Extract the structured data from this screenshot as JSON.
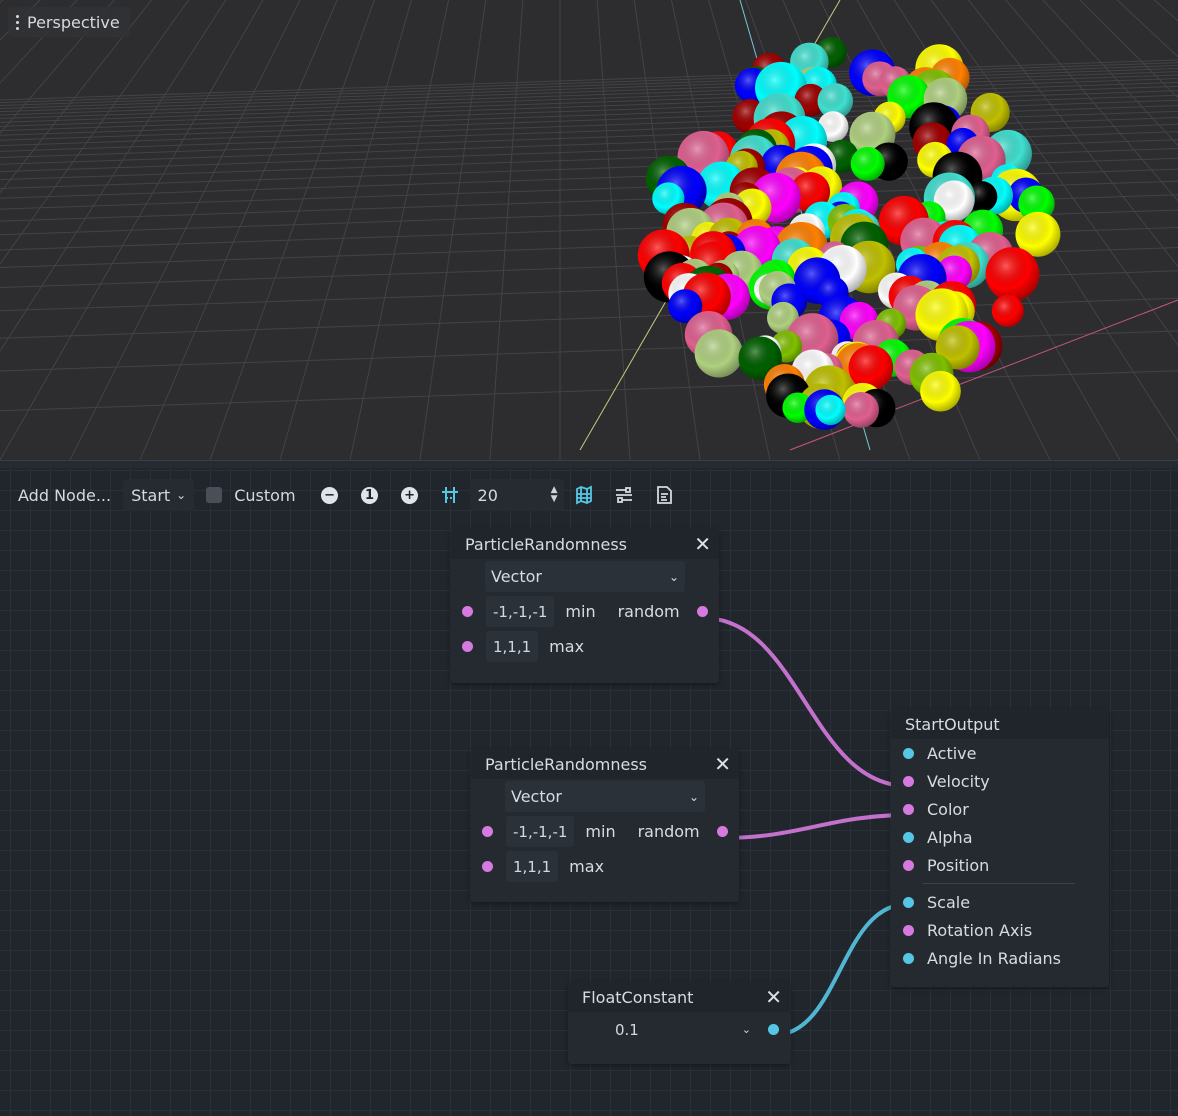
{
  "viewport": {
    "menu_label": "Perspective",
    "sphere_colors": [
      "#00ff00",
      "#ff0000",
      "#0000ff",
      "#ffff00",
      "#ff00ff",
      "#00ffff",
      "#000000",
      "#ffffff",
      "#ff8000",
      "#80c000",
      "#40e0d0",
      "#e06090",
      "#a00000",
      "#006000",
      "#b0d080",
      "#c0c000"
    ]
  },
  "toolbar": {
    "add_node_label": "Add Node...",
    "stage_select": "Start",
    "custom_label": "Custom",
    "zoom_out_icon": "minus-circle-icon",
    "zoom_reset_label": "1",
    "zoom_in_icon": "plus-circle-icon",
    "snap_icon": "snap-grid-icon",
    "snap_value": "20",
    "minimap_icon": "minimap-icon",
    "arrange_icon": "arrange-icon",
    "script_icon": "script-icon"
  },
  "nodes": {
    "random1": {
      "title": "ParticleRandomness",
      "type_select": "Vector",
      "min_value": "-1,-1,-1",
      "min_label": "min",
      "max_value": "1,1,1",
      "max_label": "max",
      "output_label": "random"
    },
    "random2": {
      "title": "ParticleRandomness",
      "type_select": "Vector",
      "min_value": "-1,-1,-1",
      "min_label": "min",
      "max_value": "1,1,1",
      "max_label": "max",
      "output_label": "random"
    },
    "float": {
      "title": "FloatConstant",
      "value": "0.1"
    },
    "output": {
      "title": "StartOutput",
      "ports": [
        "Active",
        "Velocity",
        "Color",
        "Alpha",
        "Position",
        "Scale",
        "Rotation Axis",
        "Angle In Radians"
      ]
    }
  },
  "colors": {
    "port_vector": "#d67ae0",
    "port_scalar": "#55c7e4"
  }
}
